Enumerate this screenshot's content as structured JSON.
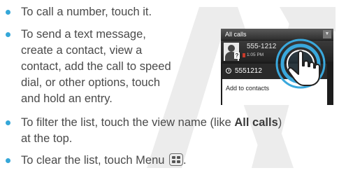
{
  "bullets": {
    "b1": "To call a number, touch it.",
    "b2": {
      "line1": "To send a text message,",
      "line2": "create a contact, view a",
      "line3": "contact, add the call to speed",
      "line4": "dial, or other options, touch",
      "line5": "and hold an entry."
    },
    "b3": {
      "prefix": "To filter the list, touch the view name (like ",
      "bold": "All calls",
      "suffix": ")",
      "line2": "at the top."
    },
    "b4": {
      "prefix": "To clear the list, touch Menu ",
      "suffix": "."
    }
  },
  "phone": {
    "title": "All calls",
    "row1": {
      "number": "555-1212",
      "time": "1:05 PM"
    },
    "popup": {
      "header_number": "5551212",
      "item": "Add to contacts"
    }
  },
  "colors": {
    "bullet": "#35a7d8",
    "text": "#4a4a4a",
    "ring": "#3aa8dc",
    "watermark": "#e6e6e6"
  },
  "icons": [
    "bullet-dot-icon",
    "menu-key-icon",
    "dropdown-arrow-icon",
    "contact-avatar-icon",
    "clock-icon",
    "touch-ring-icon",
    "hand-icon"
  ]
}
